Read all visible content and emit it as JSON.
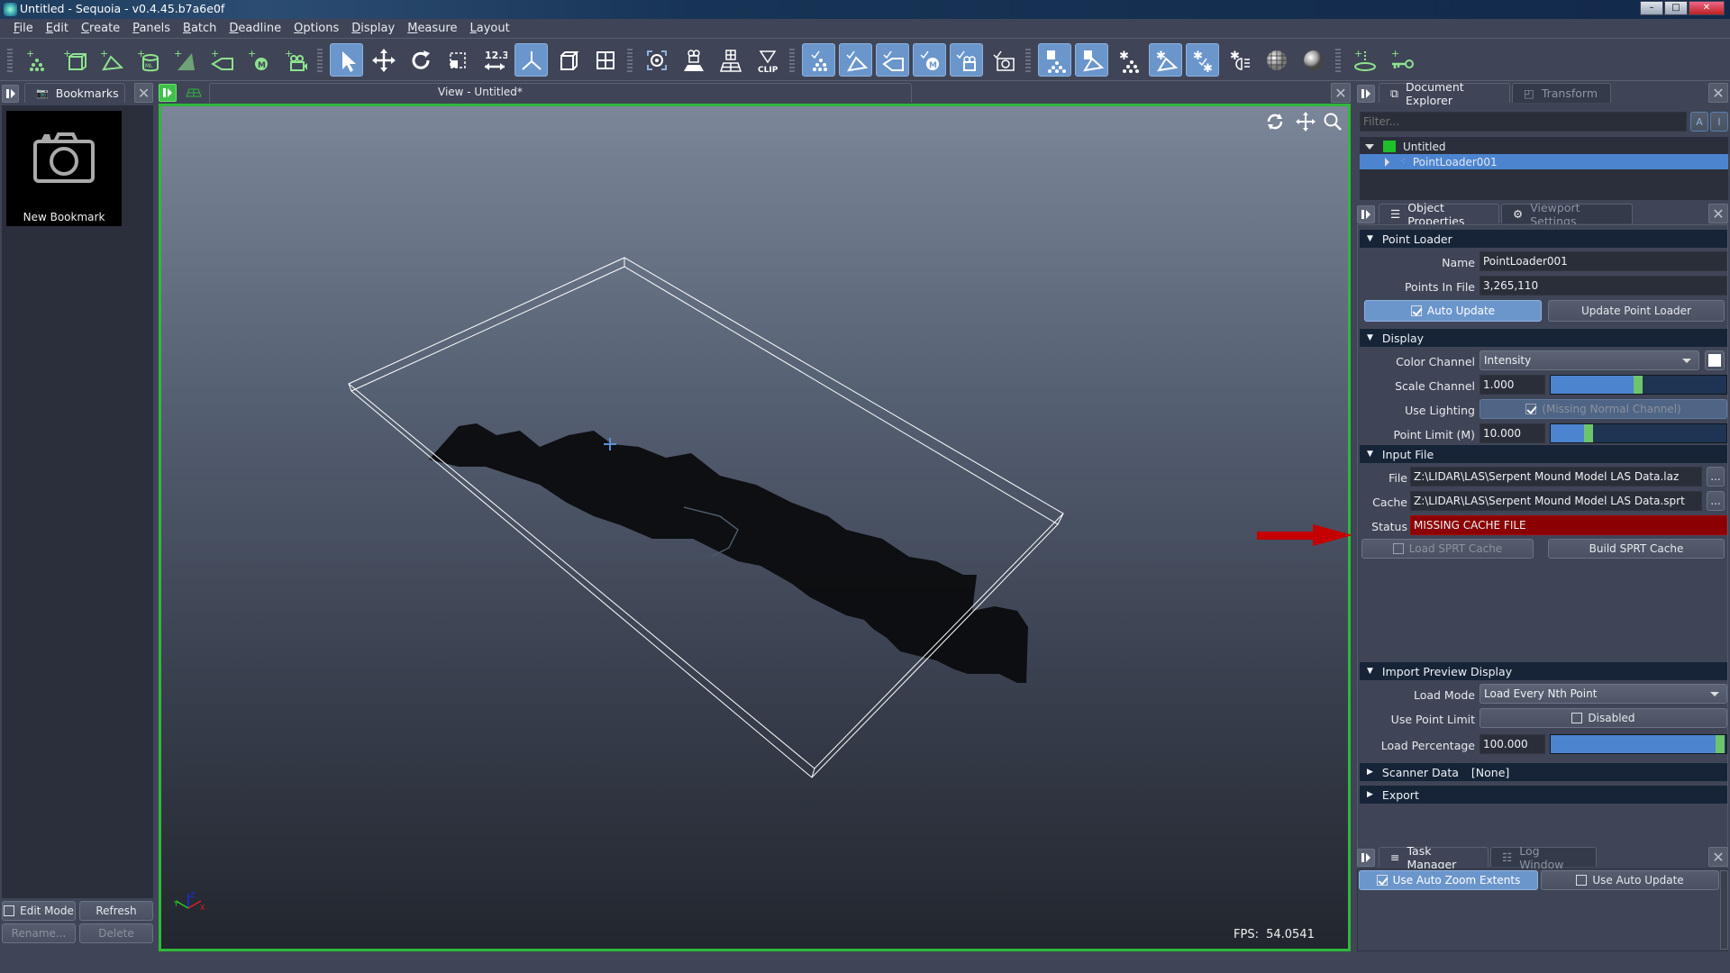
{
  "window": {
    "title": "Untitled - Sequoia - v0.4.45.b7a6e0f"
  },
  "menu": [
    {
      "label": "File",
      "mnemonic": "F",
      "rest": "ile"
    },
    {
      "label": "Edit",
      "mnemonic": "E",
      "rest": "dit"
    },
    {
      "label": "Create",
      "mnemonic": "C",
      "rest": "reate"
    },
    {
      "label": "Panels",
      "mnemonic": "P",
      "rest": "anels"
    },
    {
      "label": "Batch",
      "mnemonic": "B",
      "rest": "atch"
    },
    {
      "label": "Deadline",
      "mnemonic": "D",
      "rest": "eadline"
    },
    {
      "label": "Options",
      "mnemonic": "O",
      "rest": "ptions"
    },
    {
      "label": "Display",
      "mnemonic": "D",
      "rest": "isplay"
    },
    {
      "label": "Measure",
      "mnemonic": "M",
      "rest": "easure"
    },
    {
      "label": "Layout",
      "mnemonic": "L",
      "rest": "ayout"
    }
  ],
  "toolbar": {
    "create_tools": [
      "create-point-loader-icon",
      "create-mesh-loader-icon",
      "create-mesher-icon",
      "create-ml-loader-icon",
      "create-point-mesher-icon",
      "create-frustum-icon",
      "create-measure-icon",
      "create-camera-icon"
    ],
    "transform_tools": [
      {
        "icon": "select-arrow-icon",
        "active": true
      },
      {
        "icon": "move-icon",
        "active": false
      },
      {
        "icon": "rotate-icon",
        "active": false
      },
      {
        "icon": "scale-icon",
        "active": false
      },
      {
        "icon": "measure-distance-icon",
        "label": "12.3",
        "active": false
      },
      {
        "icon": "axis-gizmo-icon",
        "active": true
      },
      {
        "icon": "cube-view-icon",
        "active": false
      },
      {
        "icon": "quad-view-icon",
        "active": false
      }
    ],
    "view_tools": [
      {
        "icon": "zoom-extents-icon"
      },
      {
        "icon": "camera-ground-icon"
      },
      {
        "icon": "grid-plane-icon"
      },
      {
        "icon": "clip-icon",
        "label": "CLIP"
      }
    ],
    "visibility_tools": [
      {
        "icon": "show-points-icon",
        "active": true
      },
      {
        "icon": "show-meshes-icon",
        "active": true
      },
      {
        "icon": "show-frustums-icon",
        "active": true
      },
      {
        "icon": "show-measures-icon",
        "active": true
      },
      {
        "icon": "show-cameras-icon",
        "active": true
      },
      {
        "icon": "show-images-icon",
        "active": false
      }
    ],
    "lighting_tools": [
      {
        "icon": "lock-points-icon",
        "active": true
      },
      {
        "icon": "lock-meshes-icon",
        "active": true
      },
      {
        "icon": "light-points-icon",
        "active": false
      },
      {
        "icon": "light-meshes-icon",
        "active": true
      },
      {
        "icon": "light-all-icon",
        "active": true
      },
      {
        "icon": "headlight-icon",
        "active": false
      },
      {
        "icon": "wireframe-sphere-icon",
        "active": false
      },
      {
        "icon": "shaded-sphere-icon",
        "active": false
      }
    ],
    "extra_tools": [
      "create-ground-plane-icon",
      "create-key-icon"
    ]
  },
  "left_panel": {
    "tab": "Bookmarks",
    "bookmark_label": "New Bookmark",
    "edit_mode_label": "Edit Mode",
    "edit_mode_checked": false,
    "refresh_label": "Refresh",
    "rename_label": "Rename...",
    "delete_label": "Delete"
  },
  "viewport": {
    "title": "View - Untitled*",
    "fps_label": "FPS:",
    "fps_value": "54.0541",
    "axis_labels": {
      "x": "X",
      "y": "Y",
      "z": "Z"
    }
  },
  "document_explorer": {
    "tab": "Document Explorer",
    "tab2": "Transform",
    "filter_placeholder": "Filter...",
    "tree": [
      {
        "label": "Untitled",
        "expanded": true,
        "color": "#1fbf2a"
      },
      {
        "label": "PointLoader001",
        "selected": true
      }
    ]
  },
  "object_properties": {
    "tab": "Object Properties",
    "tab2": "Viewport Settings",
    "point_loader": {
      "title": "Point Loader",
      "name_label": "Name",
      "name_value": "PointLoader001",
      "points_label": "Points In File",
      "points_value": "3,265,110",
      "auto_update_label": "Auto Update",
      "auto_update_checked": true,
      "update_button": "Update Point Loader"
    },
    "display": {
      "title": "Display",
      "color_channel_label": "Color Channel",
      "color_channel_value": "Intensity",
      "scale_channel_label": "Scale Channel",
      "scale_channel_value": "1.000",
      "scale_slider_fraction": 0.5,
      "use_lighting_label": "Use Lighting",
      "use_lighting_text": "(Missing Normal Channel)",
      "use_lighting_checked": true,
      "point_limit_label": "Point Limit (M)",
      "point_limit_value": "10.000",
      "point_limit_slider_fraction": 0.2
    },
    "input_file": {
      "title": "Input File",
      "file_label": "File",
      "file_value": "Z:\\LIDAR\\LAS\\Serpent Mound Model LAS Data.laz",
      "cache_label": "Cache",
      "cache_value": "Z:\\LIDAR\\LAS\\Serpent Mound Model LAS Data.sprt",
      "browse_label": "...",
      "status_label": "Status",
      "status_value": "MISSING CACHE FILE",
      "status_color": "#8b0000",
      "load_cache_label": "Load SPRT Cache",
      "load_cache_checked": false,
      "build_cache_label": "Build SPRT Cache"
    },
    "import_preview": {
      "title": "Import Preview Display",
      "load_mode_label": "Load Mode",
      "load_mode_value": "Load Every Nth Point",
      "use_point_limit_label": "Use Point Limit",
      "use_point_limit_text": "Disabled",
      "use_point_limit_checked": false,
      "load_percentage_label": "Load Percentage",
      "load_percentage_value": "100.000",
      "load_percentage_fraction": 1.0
    },
    "scanner_data": {
      "title": "Scanner Data",
      "value": "[None]"
    },
    "export": {
      "title": "Export"
    }
  },
  "task_manager": {
    "tab": "Task Manager",
    "tab2": "Log Window",
    "auto_zoom_label": "Use Auto Zoom Extents",
    "auto_zoom_checked": true,
    "auto_update_label": "Use Auto Update",
    "auto_update_checked": false
  },
  "colors": {
    "accent": "#6b96cc",
    "viewport_border": "#2fb83a",
    "status_error": "#8b0000",
    "slider_knob": "#6dc46d"
  }
}
